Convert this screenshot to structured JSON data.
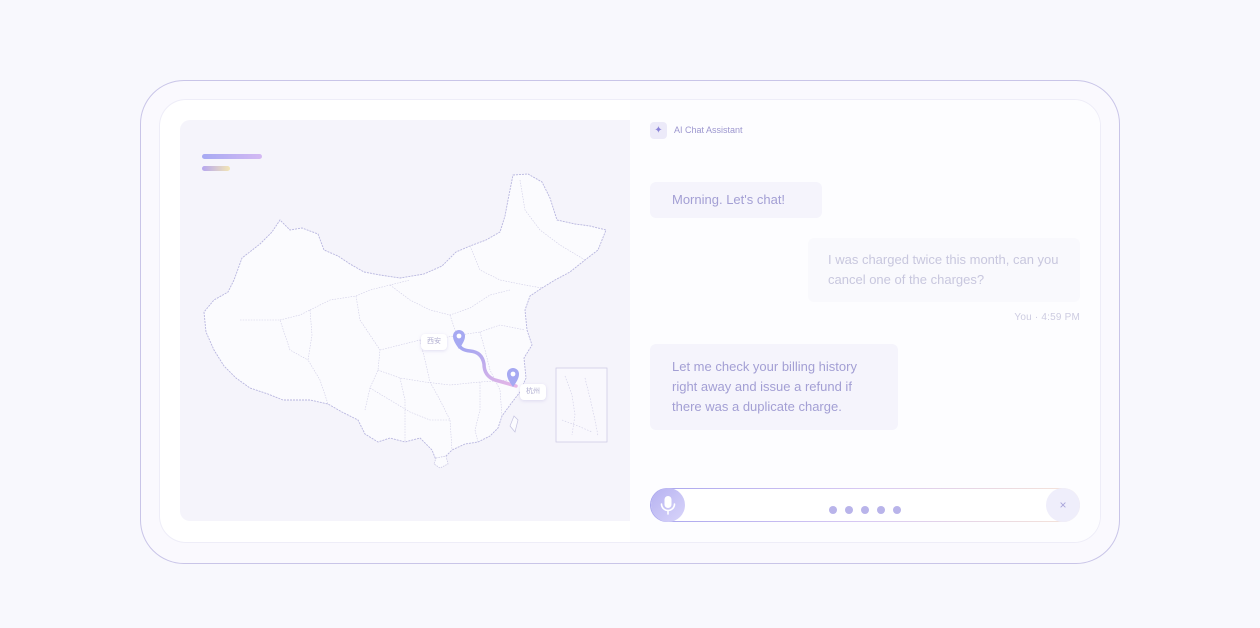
{
  "map": {
    "origin_label": "西安",
    "destination_label": "杭州",
    "route_colors": [
      "#9fa5f2",
      "#e7b6e6"
    ]
  },
  "chat": {
    "assistant_title": "AI Chat Assistant",
    "messages": [
      {
        "role": "assistant",
        "text": "Morning. Let's chat!"
      },
      {
        "role": "user",
        "text": "I was charged twice this month, can you cancel one of the charges?"
      },
      {
        "role": "assistant",
        "text": "Let me check your billing history right away and issue a refund if there was a duplicate charge."
      }
    ],
    "user_meta": "You · 4:59 PM",
    "voice": {
      "mic_icon": "microphone-icon",
      "close_label": "×"
    }
  },
  "colors": {
    "accent": "#a9a6ee",
    "frame": "#c9c5e8",
    "background": "#f8f8fd"
  }
}
